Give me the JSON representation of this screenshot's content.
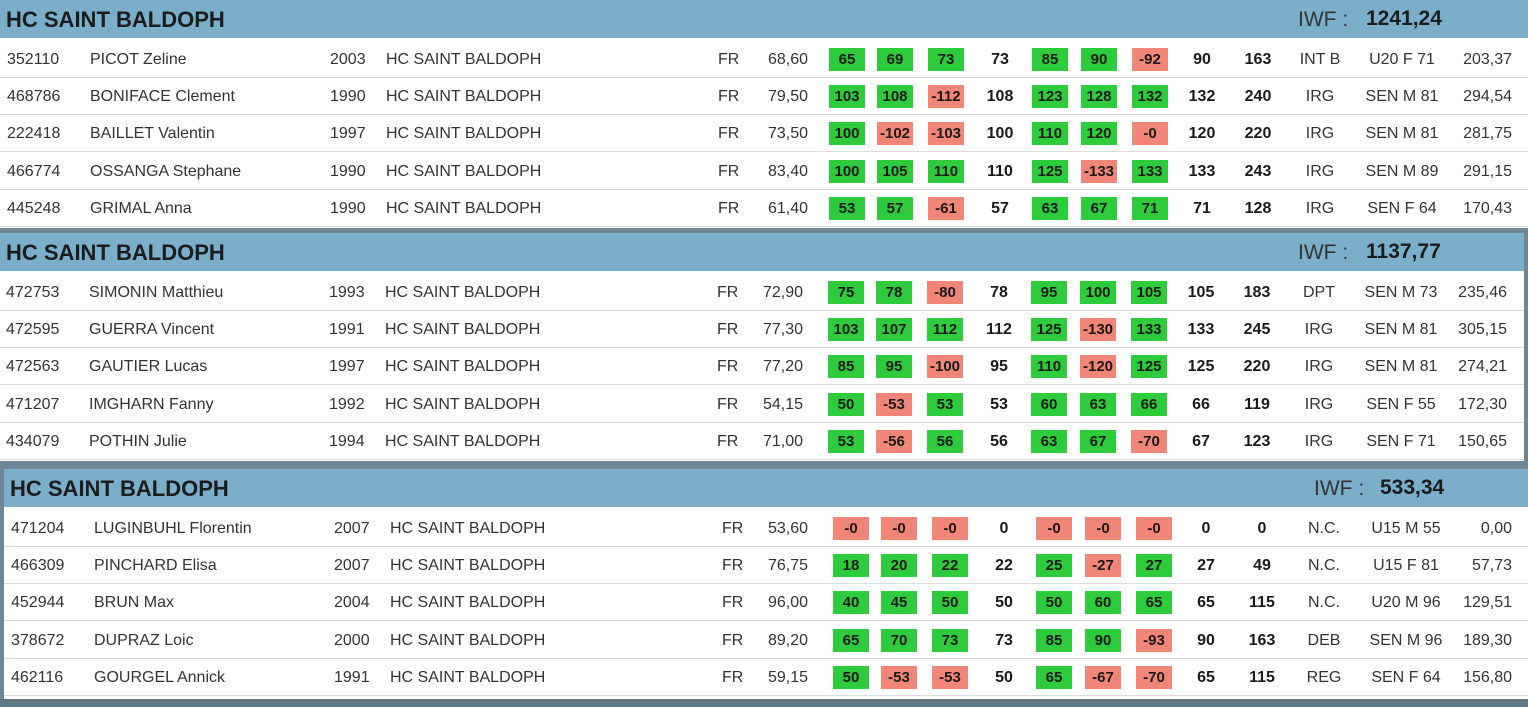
{
  "teams": [
    {
      "name": "HC SAINT BALDOPH",
      "iwf_label": "IWF :",
      "iwf_value": "1241,24",
      "athletes": [
        {
          "id": "352110",
          "name": "PICOT Zeline",
          "year": "2003",
          "club": "HC SAINT BALDOPH",
          "nat": "FR",
          "weight": "68,60",
          "attempts": [
            {
              "v": "65",
              "ok": true
            },
            {
              "v": "69",
              "ok": true
            },
            {
              "v": "73",
              "ok": true
            },
            {
              "v": "85",
              "ok": true
            },
            {
              "v": "90",
              "ok": true
            },
            {
              "v": "-92",
              "ok": false
            }
          ],
          "best_snatch": "73",
          "best_cj": "90",
          "total": "163",
          "level": "INT B",
          "category": "U20 F 71",
          "iwf": "203,37"
        },
        {
          "id": "468786",
          "name": "BONIFACE Clement",
          "year": "1990",
          "club": "HC SAINT BALDOPH",
          "nat": "FR",
          "weight": "79,50",
          "attempts": [
            {
              "v": "103",
              "ok": true
            },
            {
              "v": "108",
              "ok": true
            },
            {
              "v": "-112",
              "ok": false
            },
            {
              "v": "123",
              "ok": true
            },
            {
              "v": "128",
              "ok": true
            },
            {
              "v": "132",
              "ok": true
            }
          ],
          "best_snatch": "108",
          "best_cj": "132",
          "total": "240",
          "level": "IRG",
          "category": "SEN M 81",
          "iwf": "294,54"
        },
        {
          "id": "222418",
          "name": "BAILLET Valentin",
          "year": "1997",
          "club": "HC SAINT BALDOPH",
          "nat": "FR",
          "weight": "73,50",
          "attempts": [
            {
              "v": "100",
              "ok": true
            },
            {
              "v": "-102",
              "ok": false
            },
            {
              "v": "-103",
              "ok": false
            },
            {
              "v": "110",
              "ok": true
            },
            {
              "v": "120",
              "ok": true
            },
            {
              "v": "-0",
              "ok": false
            }
          ],
          "best_snatch": "100",
          "best_cj": "120",
          "total": "220",
          "level": "IRG",
          "category": "SEN M 81",
          "iwf": "281,75"
        },
        {
          "id": "466774",
          "name": "OSSANGA Stephane",
          "year": "1990",
          "club": "HC SAINT BALDOPH",
          "nat": "FR",
          "weight": "83,40",
          "attempts": [
            {
              "v": "100",
              "ok": true
            },
            {
              "v": "105",
              "ok": true
            },
            {
              "v": "110",
              "ok": true
            },
            {
              "v": "125",
              "ok": true
            },
            {
              "v": "-133",
              "ok": false
            },
            {
              "v": "133",
              "ok": true
            }
          ],
          "best_snatch": "110",
          "best_cj": "133",
          "total": "243",
          "level": "IRG",
          "category": "SEN M 89",
          "iwf": "291,15"
        },
        {
          "id": "445248",
          "name": "GRIMAL Anna",
          "year": "1990",
          "club": "HC SAINT BALDOPH",
          "nat": "FR",
          "weight": "61,40",
          "attempts": [
            {
              "v": "53",
              "ok": true
            },
            {
              "v": "57",
              "ok": true
            },
            {
              "v": "-61",
              "ok": false
            },
            {
              "v": "63",
              "ok": true
            },
            {
              "v": "67",
              "ok": true
            },
            {
              "v": "71",
              "ok": true
            }
          ],
          "best_snatch": "57",
          "best_cj": "71",
          "total": "128",
          "level": "IRG",
          "category": "SEN F 64",
          "iwf": "170,43"
        }
      ]
    },
    {
      "name": "HC SAINT BALDOPH",
      "iwf_label": "IWF :",
      "iwf_value": "1137,77",
      "athletes": [
        {
          "id": "472753",
          "name": "SIMONIN Matthieu",
          "year": "1993",
          "club": "HC SAINT BALDOPH",
          "nat": "FR",
          "weight": "72,90",
          "attempts": [
            {
              "v": "75",
              "ok": true
            },
            {
              "v": "78",
              "ok": true
            },
            {
              "v": "-80",
              "ok": false
            },
            {
              "v": "95",
              "ok": true
            },
            {
              "v": "100",
              "ok": true
            },
            {
              "v": "105",
              "ok": true
            }
          ],
          "best_snatch": "78",
          "best_cj": "105",
          "total": "183",
          "level": "DPT",
          "category": "SEN M 73",
          "iwf": "235,46"
        },
        {
          "id": "472595",
          "name": "GUERRA Vincent",
          "year": "1991",
          "club": "HC SAINT BALDOPH",
          "nat": "FR",
          "weight": "77,30",
          "attempts": [
            {
              "v": "103",
              "ok": true
            },
            {
              "v": "107",
              "ok": true
            },
            {
              "v": "112",
              "ok": true
            },
            {
              "v": "125",
              "ok": true
            },
            {
              "v": "-130",
              "ok": false
            },
            {
              "v": "133",
              "ok": true
            }
          ],
          "best_snatch": "112",
          "best_cj": "133",
          "total": "245",
          "level": "IRG",
          "category": "SEN M 81",
          "iwf": "305,15"
        },
        {
          "id": "472563",
          "name": "GAUTIER Lucas",
          "year": "1997",
          "club": "HC SAINT BALDOPH",
          "nat": "FR",
          "weight": "77,20",
          "attempts": [
            {
              "v": "85",
              "ok": true
            },
            {
              "v": "95",
              "ok": true
            },
            {
              "v": "-100",
              "ok": false
            },
            {
              "v": "110",
              "ok": true
            },
            {
              "v": "-120",
              "ok": false
            },
            {
              "v": "125",
              "ok": true
            }
          ],
          "best_snatch": "95",
          "best_cj": "125",
          "total": "220",
          "level": "IRG",
          "category": "SEN M 81",
          "iwf": "274,21"
        },
        {
          "id": "471207",
          "name": "IMGHARN Fanny",
          "year": "1992",
          "club": "HC SAINT BALDOPH",
          "nat": "FR",
          "weight": "54,15",
          "attempts": [
            {
              "v": "50",
              "ok": true
            },
            {
              "v": "-53",
              "ok": false
            },
            {
              "v": "53",
              "ok": true
            },
            {
              "v": "60",
              "ok": true
            },
            {
              "v": "63",
              "ok": true
            },
            {
              "v": "66",
              "ok": true
            }
          ],
          "best_snatch": "53",
          "best_cj": "66",
          "total": "119",
          "level": "IRG",
          "category": "SEN F 55",
          "iwf": "172,30"
        },
        {
          "id": "434079",
          "name": "POTHIN Julie",
          "year": "1994",
          "club": "HC SAINT BALDOPH",
          "nat": "FR",
          "weight": "71,00",
          "attempts": [
            {
              "v": "53",
              "ok": true
            },
            {
              "v": "-56",
              "ok": false
            },
            {
              "v": "56",
              "ok": true
            },
            {
              "v": "63",
              "ok": true
            },
            {
              "v": "67",
              "ok": true
            },
            {
              "v": "-70",
              "ok": false
            }
          ],
          "best_snatch": "56",
          "best_cj": "67",
          "total": "123",
          "level": "IRG",
          "category": "SEN F 71",
          "iwf": "150,65"
        }
      ]
    },
    {
      "name": "HC SAINT BALDOPH",
      "iwf_label": "IWF :",
      "iwf_value": "533,34",
      "athletes": [
        {
          "id": "471204",
          "name": "LUGINBUHL Florentin",
          "year": "2007",
          "club": "HC SAINT BALDOPH",
          "nat": "FR",
          "weight": "53,60",
          "attempts": [
            {
              "v": "-0",
              "ok": false
            },
            {
              "v": "-0",
              "ok": false
            },
            {
              "v": "-0",
              "ok": false
            },
            {
              "v": "-0",
              "ok": false
            },
            {
              "v": "-0",
              "ok": false
            },
            {
              "v": "-0",
              "ok": false
            }
          ],
          "best_snatch": "0",
          "best_cj": "0",
          "total": "0",
          "level": "N.C.",
          "category": "U15 M 55",
          "iwf": "0,00"
        },
        {
          "id": "466309",
          "name": "PINCHARD Elisa",
          "year": "2007",
          "club": "HC SAINT BALDOPH",
          "nat": "FR",
          "weight": "76,75",
          "attempts": [
            {
              "v": "18",
              "ok": true
            },
            {
              "v": "20",
              "ok": true
            },
            {
              "v": "22",
              "ok": true
            },
            {
              "v": "25",
              "ok": true
            },
            {
              "v": "-27",
              "ok": false
            },
            {
              "v": "27",
              "ok": true
            }
          ],
          "best_snatch": "22",
          "best_cj": "27",
          "total": "49",
          "level": "N.C.",
          "category": "U15 F 81",
          "iwf": "57,73"
        },
        {
          "id": "452944",
          "name": "BRUN Max",
          "year": "2004",
          "club": "HC SAINT BALDOPH",
          "nat": "FR",
          "weight": "96,00",
          "attempts": [
            {
              "v": "40",
              "ok": true
            },
            {
              "v": "45",
              "ok": true
            },
            {
              "v": "50",
              "ok": true
            },
            {
              "v": "50",
              "ok": true
            },
            {
              "v": "60",
              "ok": true
            },
            {
              "v": "65",
              "ok": true
            }
          ],
          "best_snatch": "50",
          "best_cj": "65",
          "total": "115",
          "level": "N.C.",
          "category": "U20 M 96",
          "iwf": "129,51"
        },
        {
          "id": "378672",
          "name": "DUPRAZ Loic",
          "year": "2000",
          "club": "HC SAINT BALDOPH",
          "nat": "FR",
          "weight": "89,20",
          "attempts": [
            {
              "v": "65",
              "ok": true
            },
            {
              "v": "70",
              "ok": true
            },
            {
              "v": "73",
              "ok": true
            },
            {
              "v": "85",
              "ok": true
            },
            {
              "v": "90",
              "ok": true
            },
            {
              "v": "-93",
              "ok": false
            }
          ],
          "best_snatch": "73",
          "best_cj": "90",
          "total": "163",
          "level": "DEB",
          "category": "SEN M 96",
          "iwf": "189,30"
        },
        {
          "id": "462116",
          "name": "GOURGEL Annick",
          "year": "1991",
          "club": "HC SAINT BALDOPH",
          "nat": "FR",
          "weight": "59,15",
          "attempts": [
            {
              "v": "50",
              "ok": true
            },
            {
              "v": "-53",
              "ok": false
            },
            {
              "v": "-53",
              "ok": false
            },
            {
              "v": "65",
              "ok": true
            },
            {
              "v": "-67",
              "ok": false
            },
            {
              "v": "-70",
              "ok": false
            }
          ],
          "best_snatch": "50",
          "best_cj": "65",
          "total": "115",
          "level": "REG",
          "category": "SEN F 64",
          "iwf": "156,80"
        }
      ]
    }
  ],
  "colors": {
    "header_bg": "#7aaec9",
    "success": "#2ecc3c",
    "failure": "#f08578"
  }
}
